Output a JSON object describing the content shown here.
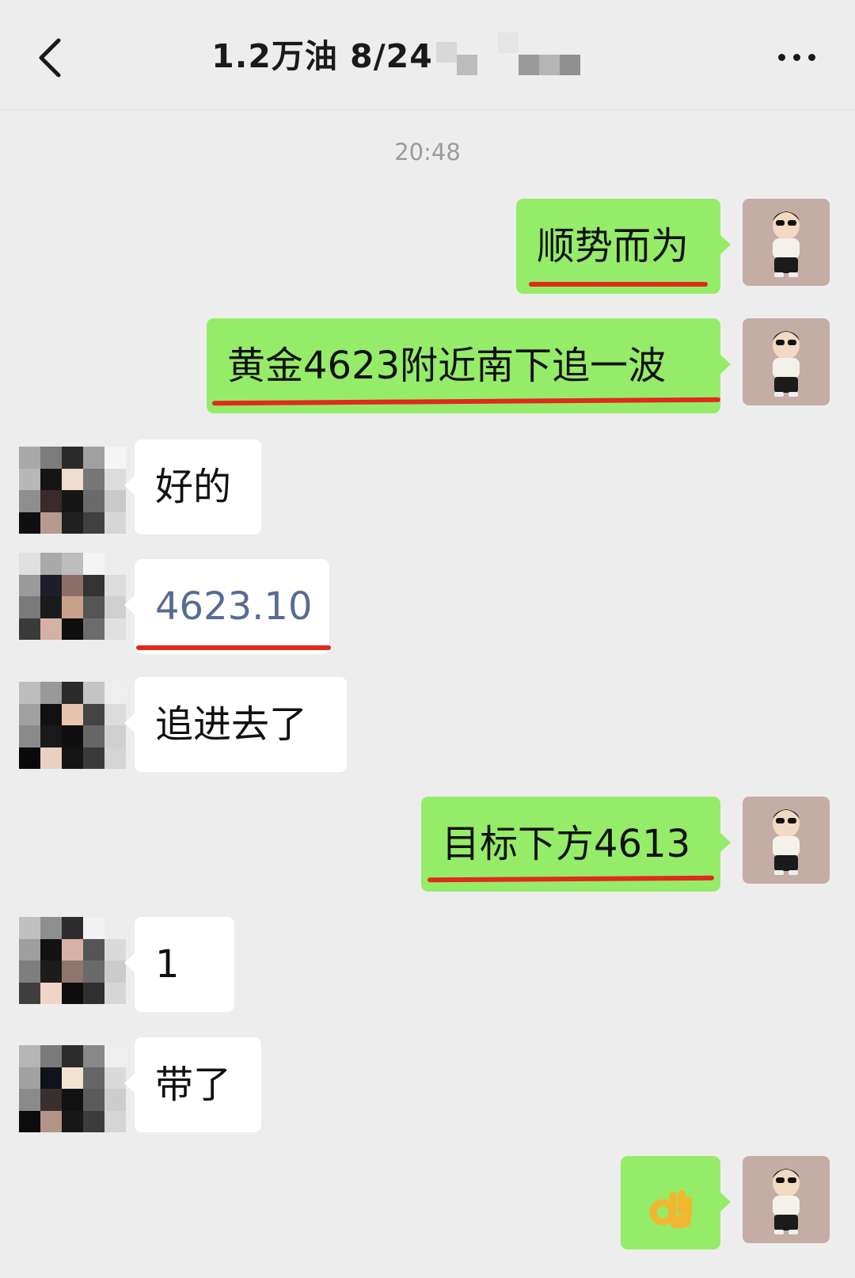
{
  "header": {
    "title": "1.2万油  8/24",
    "back_icon": "chevron-left-icon",
    "more_icon": "more-dots-icon"
  },
  "timestamp": "20:48",
  "messages": [
    {
      "from": "me",
      "text": "顺势而为",
      "underline": true
    },
    {
      "from": "me",
      "text": "黄金4623附近南下追一波",
      "underline": true
    },
    {
      "from": "them",
      "text": "好的"
    },
    {
      "from": "them",
      "text": "4623.10",
      "link": true,
      "underline": true
    },
    {
      "from": "them",
      "text": "追进去了"
    },
    {
      "from": "me",
      "text": "目标下方4613",
      "underline": true
    },
    {
      "from": "them",
      "text": "1"
    },
    {
      "from": "them",
      "text": "带了"
    },
    {
      "from": "me",
      "text": "👌",
      "emoji": "ok-hand-emoji"
    }
  ],
  "colors": {
    "outgoing_bubble": "#95ec69",
    "incoming_bubble": "#ffffff",
    "underline": "#e02a1c",
    "link": "#576b95",
    "background": "#ededed"
  }
}
